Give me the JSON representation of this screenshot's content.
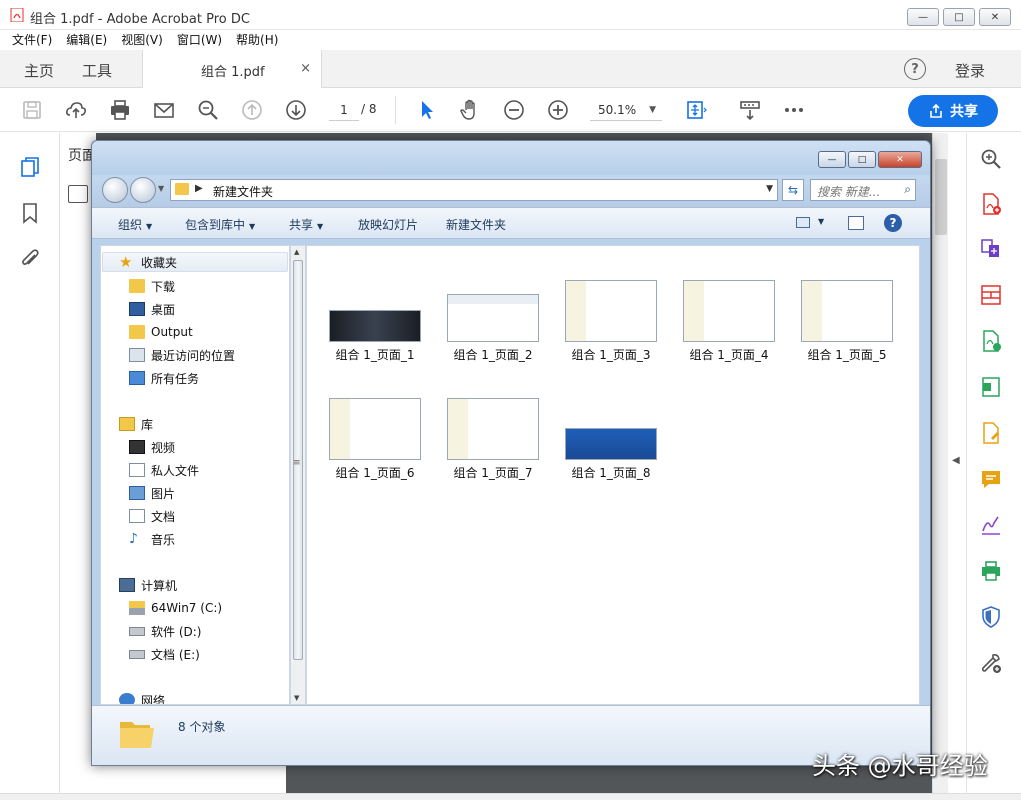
{
  "window": {
    "title": "组合 1.pdf - Adobe Acrobat Pro DC",
    "controls": {
      "minimize": "—",
      "maximize": "□",
      "close": "✕"
    }
  },
  "menu": [
    "文件(F)",
    "编辑(E)",
    "视图(V)",
    "窗口(W)",
    "帮助(H)"
  ],
  "tabs": {
    "home": "主页",
    "tools": "工具",
    "doc": "组合 1.pdf",
    "doc_close": "×",
    "help": "?",
    "login": "登录"
  },
  "toolbar": {
    "page_current": "1",
    "page_total": "/ 8",
    "zoom": "50.1%",
    "share_label": "共享"
  },
  "pages_panel": {
    "label": "页面"
  },
  "explorer": {
    "address": {
      "path": "新建文件夹",
      "search_placeholder": "搜索 新建..."
    },
    "commands": [
      "组织",
      "包含到库中",
      "共享",
      "放映幻灯片",
      "新建文件夹"
    ],
    "nav": {
      "favorites": "收藏夹",
      "favorites_items": [
        "下载",
        "桌面",
        "Output",
        "最近访问的位置",
        "所有任务"
      ],
      "libraries": "库",
      "libraries_items": [
        "视频",
        "私人文件",
        "图片",
        "文档",
        "音乐"
      ],
      "computer": "计算机",
      "computer_items": [
        "64Win7 (C:)",
        "软件 (D:)",
        "文档 (E:)"
      ],
      "network": "网络"
    },
    "files": [
      "组合 1_页面_1",
      "组合 1_页面_2",
      "组合 1_页面_3",
      "组合 1_页面_4",
      "组合 1_页面_5",
      "组合 1_页面_6",
      "组合 1_页面_7",
      "组合 1_页面_8"
    ],
    "status_count": "8 个对象"
  },
  "watermark": "头条 @水哥经验",
  "colors": {
    "accent": "#1473e6",
    "acrobat_red": "#e4312b",
    "doc_bg": "#525659"
  }
}
